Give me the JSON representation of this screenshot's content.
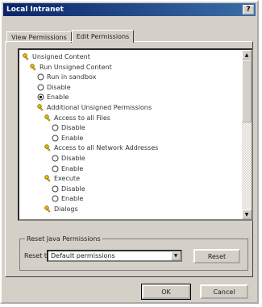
{
  "window": {
    "title": "Local Intranet",
    "help_label": "?"
  },
  "tabs": [
    {
      "label": "View Permissions"
    },
    {
      "label": "Edit Permissions"
    }
  ],
  "tree": [
    {
      "icon": "key-icon",
      "label": "Unsigned Content",
      "indent": 0
    },
    {
      "icon": "key-icon",
      "label": "Run Unsigned Content",
      "indent": 1
    },
    {
      "icon": "radio-icon",
      "label": "Run in sandbox",
      "indent": 2
    },
    {
      "icon": "radio-icon",
      "label": "Disable",
      "indent": 2
    },
    {
      "icon": "radio-selected-icon",
      "label": "Enable",
      "indent": 2
    },
    {
      "icon": "key-icon",
      "label": "Additional Unsigned Permissions",
      "indent": 2
    },
    {
      "icon": "key-icon",
      "label": "Access to all Files",
      "indent": 3
    },
    {
      "icon": "radio-icon",
      "label": "Disable",
      "indent": 4
    },
    {
      "icon": "radio-icon",
      "label": "Enable",
      "indent": 4
    },
    {
      "icon": "key-icon",
      "label": "Access to all Network Addresses",
      "indent": 3
    },
    {
      "icon": "radio-icon",
      "label": "Disable",
      "indent": 4
    },
    {
      "icon": "radio-icon",
      "label": "Enable",
      "indent": 4
    },
    {
      "icon": "key-icon",
      "label": "Execute",
      "indent": 3
    },
    {
      "icon": "radio-icon",
      "label": "Disable",
      "indent": 4
    },
    {
      "icon": "radio-icon",
      "label": "Enable",
      "indent": 4
    },
    {
      "icon": "key-icon",
      "label": "Dialogs",
      "indent": 3
    }
  ],
  "reset_group": {
    "legend": "Reset Java Permissions",
    "reset_to_label": "Reset to:",
    "select_value": "Default permissions",
    "reset_button": "Reset"
  },
  "footer": {
    "ok": "OK",
    "cancel": "Cancel"
  }
}
